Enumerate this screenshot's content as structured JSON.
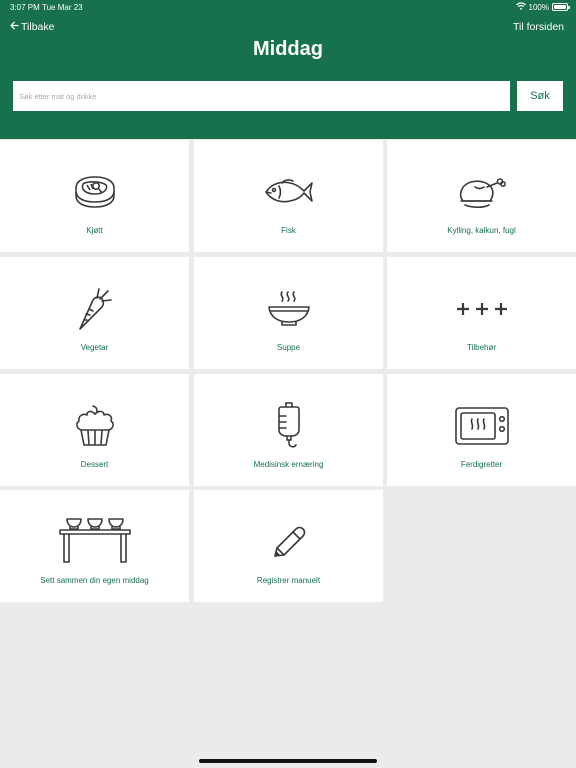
{
  "status_bar": {
    "time": "3:07 PM",
    "date": "Tue Mar 23",
    "battery": "100%",
    "battery_level": 1.0
  },
  "nav": {
    "back_label": "Tilbake",
    "home_label": "Til forsiden"
  },
  "page": {
    "title": "Middag"
  },
  "search": {
    "placeholder": "Søk etter mat og drikke",
    "value": "",
    "button_label": "Søk"
  },
  "colors": {
    "brand": "#16714c",
    "background": "#ebebeb",
    "tile": "#ffffff",
    "icon": "#3a3a3a"
  },
  "tiles": [
    {
      "label": "Kjøtt",
      "icon": "steak-icon"
    },
    {
      "label": "Fisk",
      "icon": "fish-icon"
    },
    {
      "label": "Kylling, kalkun, fugl",
      "icon": "chicken-icon"
    },
    {
      "label": "Vegetar",
      "icon": "carrot-icon"
    },
    {
      "label": "Suppe",
      "icon": "soup-bowl-icon"
    },
    {
      "label": "Tilbehør",
      "icon": "plus-signs-icon"
    },
    {
      "label": "Dessert",
      "icon": "cupcake-icon"
    },
    {
      "label": "Medisinsk ernæring",
      "icon": "iv-bag-icon"
    },
    {
      "label": "Ferdigretter",
      "icon": "microwave-icon"
    },
    {
      "label": "Sett sammen din egen middag",
      "icon": "table-bowls-icon"
    },
    {
      "label": "Registrer manuelt",
      "icon": "pencil-icon"
    }
  ]
}
